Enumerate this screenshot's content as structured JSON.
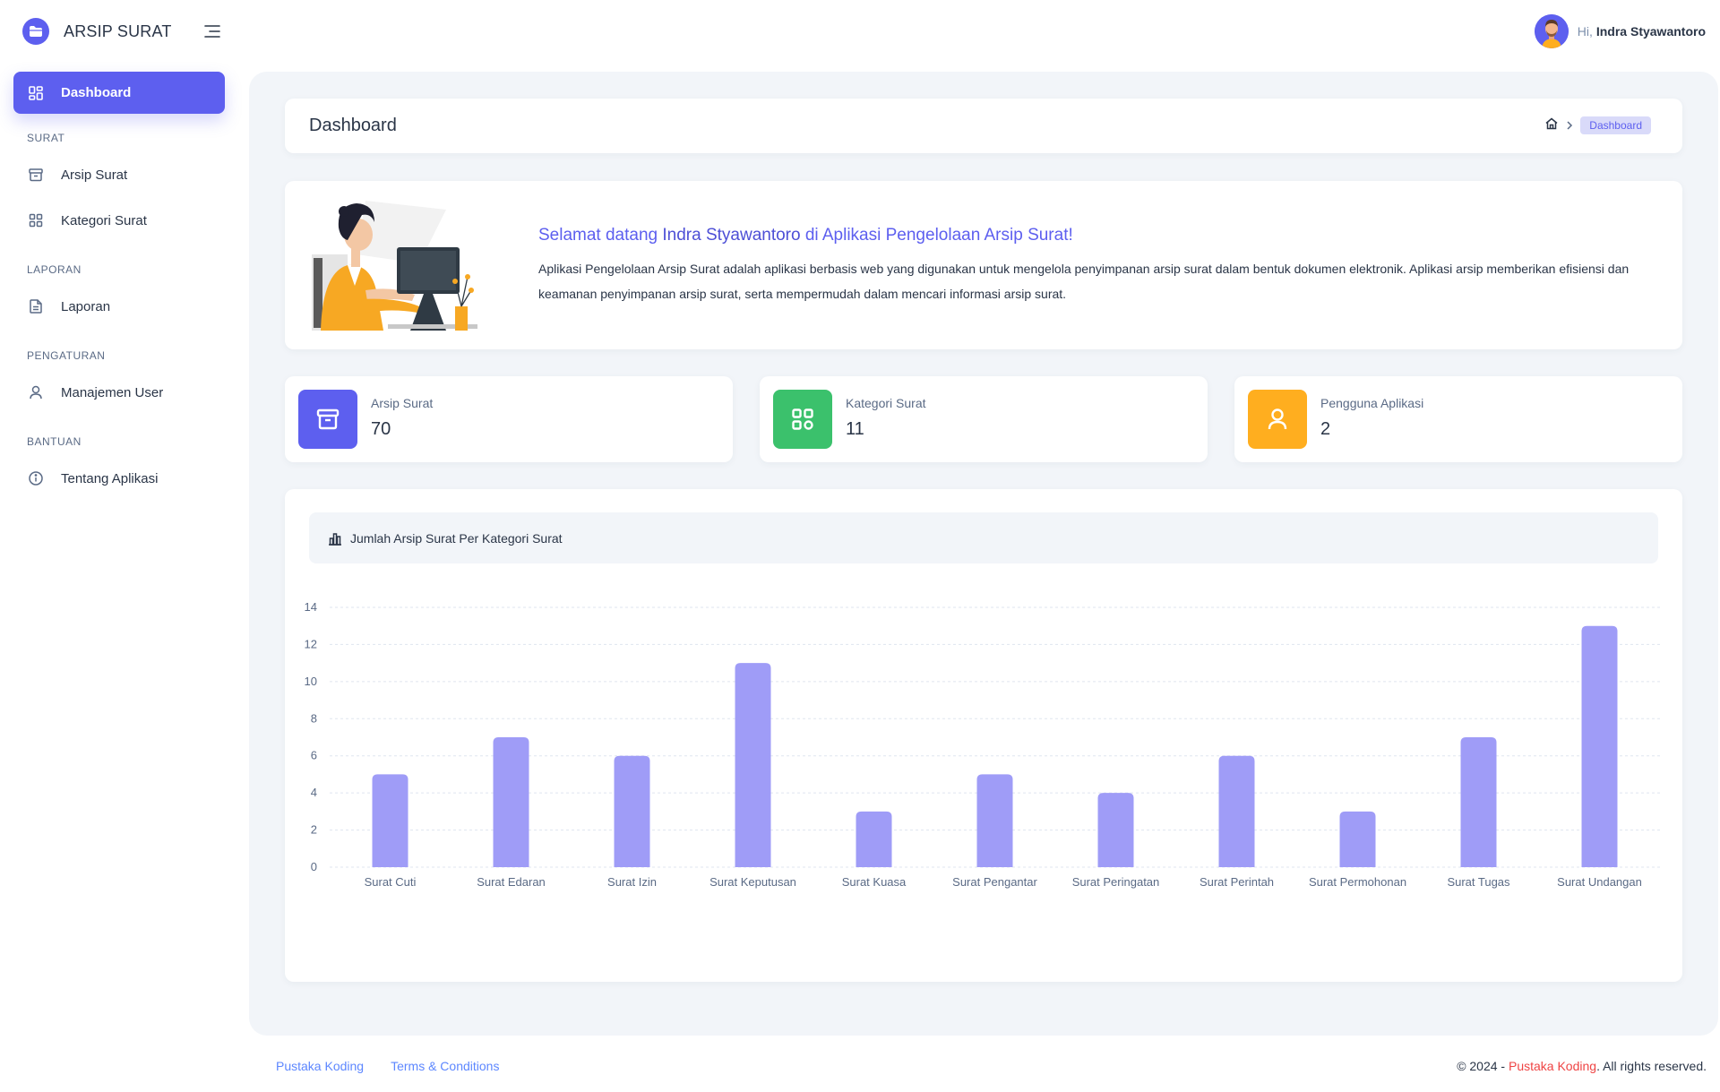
{
  "app": {
    "title": "ARSIP SURAT"
  },
  "sidebar": {
    "items": [
      {
        "label": "Dashboard",
        "icon": "dashboard-icon",
        "active": true
      },
      {
        "section": "SURAT"
      },
      {
        "label": "Arsip Surat",
        "icon": "archive-icon"
      },
      {
        "label": "Kategori Surat",
        "icon": "category-icon"
      },
      {
        "section": "LAPORAN"
      },
      {
        "label": "Laporan",
        "icon": "file-report-icon"
      },
      {
        "section": "PENGATURAN"
      },
      {
        "label": "Manajemen User",
        "icon": "user-icon"
      },
      {
        "section": "BANTUAN"
      },
      {
        "label": "Tentang Aplikasi",
        "icon": "info-icon"
      }
    ]
  },
  "header": {
    "greeting": "Hi,",
    "user_name": "Indra Styawantoro"
  },
  "page": {
    "title": "Dashboard",
    "breadcrumb_active": "Dashboard"
  },
  "welcome": {
    "title_prefix": "Selamat datang ",
    "title_name": "Indra Styawantoro",
    "title_suffix": " di Aplikasi Pengelolaan Arsip Surat!",
    "description": "Aplikasi Pengelolaan Arsip Surat adalah aplikasi berbasis web yang digunakan untuk mengelola penyimpanan arsip surat dalam bentuk dokumen elektronik. Aplikasi arsip memberikan efisiensi dan keamanan penyimpanan arsip surat, serta mempermudah dalam mencari informasi arsip surat."
  },
  "stats": [
    {
      "label": "Arsip Surat",
      "value": "70",
      "color": "#5d5fef",
      "icon": "archive-icon"
    },
    {
      "label": "Kategori Surat",
      "value": "11",
      "color": "#3bc16c",
      "icon": "category-icon"
    },
    {
      "label": "Pengguna Aplikasi",
      "value": "2",
      "color": "#ffae1f",
      "icon": "user-icon"
    }
  ],
  "chart_card": {
    "title": "Jumlah Arsip Surat Per Kategori Surat"
  },
  "chart_data": {
    "type": "bar",
    "categories": [
      "Surat Cuti",
      "Surat Edaran",
      "Surat Izin",
      "Surat Keputusan",
      "Surat Kuasa",
      "Surat Pengantar",
      "Surat Peringatan",
      "Surat Perintah",
      "Surat Permohonan",
      "Surat Tugas",
      "Surat Undangan"
    ],
    "values": [
      5,
      7,
      6,
      11,
      3,
      5,
      4,
      6,
      3,
      7,
      13
    ],
    "ylim": [
      0,
      14
    ],
    "yticks": [
      "0",
      "2",
      "4",
      "6",
      "8",
      "10",
      "12",
      "14"
    ],
    "bar_color": "#9f9cf7",
    "grid": true,
    "title": "",
    "xlabel": "",
    "ylabel": ""
  },
  "footer": {
    "links": [
      "Pustaka Koding",
      "Terms & Conditions"
    ],
    "copyright_prefix": "© 2024 - ",
    "copyright_brand": "Pustaka Koding",
    "copyright_suffix": ". All rights reserved."
  }
}
